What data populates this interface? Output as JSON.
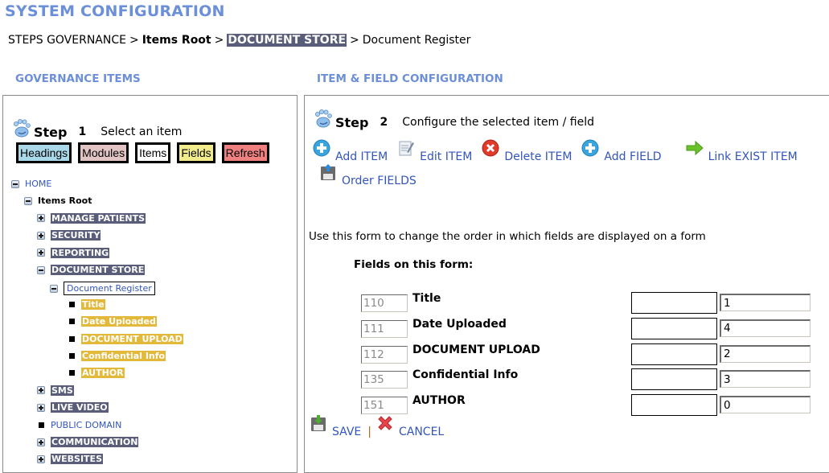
{
  "page": {
    "title": "SYSTEM CONFIGURATION"
  },
  "breadcrumb": {
    "items": [
      "STEPS GOVERNANCE",
      "Items Root",
      "DOCUMENT STORE",
      "Document Register"
    ],
    "separator": ">"
  },
  "left": {
    "section_title": "GOVERNANCE ITEMS",
    "step": {
      "word": "Step",
      "number": "1",
      "text": "Select an item",
      "icon": "paw-icon"
    },
    "buttons": [
      {
        "label": "Headings",
        "color": "#a9d8e8"
      },
      {
        "label": "Modules",
        "color": "#e2c4c4"
      },
      {
        "label": "Items",
        "color": "#ffffff"
      },
      {
        "label": "Fields",
        "color": "#f2ec8c"
      },
      {
        "label": "Refresh",
        "color": "#f08080"
      }
    ],
    "tree": [
      {
        "label": "HOME",
        "toggle": "minus",
        "style": "link",
        "level": 0
      },
      {
        "label": "Items Root",
        "toggle": "minus",
        "style": "bold",
        "level": 1
      },
      {
        "label": "MANAGE PATIENTS",
        "toggle": "plus",
        "style": "dark",
        "level": 2
      },
      {
        "label": "SECURITY",
        "toggle": "plus",
        "style": "dark",
        "level": 2
      },
      {
        "label": "REPORTING",
        "toggle": "plus",
        "style": "dark",
        "level": 2
      },
      {
        "label": "DOCUMENT STORE",
        "toggle": "minus",
        "style": "dark",
        "level": 2
      },
      {
        "label": "Document Register",
        "toggle": "minus",
        "style": "selected",
        "level": 3
      },
      {
        "label": "Title",
        "toggle": "bullet",
        "style": "yellow",
        "level": 4
      },
      {
        "label": "Date Uploaded",
        "toggle": "bullet",
        "style": "yellow",
        "level": 4
      },
      {
        "label": "DOCUMENT UPLOAD",
        "toggle": "bullet",
        "style": "yellow",
        "level": 4
      },
      {
        "label": "Confidential Info",
        "toggle": "bullet",
        "style": "yellow",
        "level": 4
      },
      {
        "label": "AUTHOR",
        "toggle": "bullet",
        "style": "yellow",
        "level": 4
      },
      {
        "label": "SMS",
        "toggle": "plus",
        "style": "dark",
        "level": 2
      },
      {
        "label": "LIVE VIDEO",
        "toggle": "plus",
        "style": "dark",
        "level": 2
      },
      {
        "label": "PUBLIC DOMAIN",
        "toggle": "bullet",
        "style": "link",
        "level": 2
      },
      {
        "label": "COMMUNICATION",
        "toggle": "plus",
        "style": "dark",
        "level": 2
      },
      {
        "label": "WEBSITES",
        "toggle": "plus",
        "style": "dark",
        "level": 2
      }
    ]
  },
  "right": {
    "section_title": "ITEM & FIELD CONFIGURATION",
    "step": {
      "word": "Step",
      "number": "2",
      "text": "Configure the selected item / field",
      "icon": "paw-icon"
    },
    "actions": [
      {
        "label": "Add ITEM",
        "icon": "add-circle-icon"
      },
      {
        "label": "Edit ITEM",
        "icon": "edit-document-icon"
      },
      {
        "label": "Delete ITEM",
        "icon": "delete-circle-icon"
      },
      {
        "label": "Add FIELD",
        "icon": "add-circle-icon"
      },
      {
        "label": "Link EXIST ITEM",
        "icon": "arrow-right-icon"
      },
      {
        "label": "Order FIELDS",
        "icon": "floppy-upload-icon"
      }
    ],
    "intro_text": "Use this form to change the order in which fields are displayed on a form",
    "fields_heading": "Fields on this form:",
    "fields": [
      {
        "id": "110",
        "label": "Title",
        "order": "1"
      },
      {
        "id": "111",
        "label": "Date Uploaded",
        "order": "4"
      },
      {
        "id": "112",
        "label": "DOCUMENT UPLOAD",
        "order": "2"
      },
      {
        "id": "135",
        "label": "Confidential Info",
        "order": "3"
      },
      {
        "id": "151",
        "label": "AUTHOR",
        "order": "0"
      }
    ],
    "save_label": "SAVE",
    "cancel_label": "CANCEL",
    "divider": "|"
  }
}
